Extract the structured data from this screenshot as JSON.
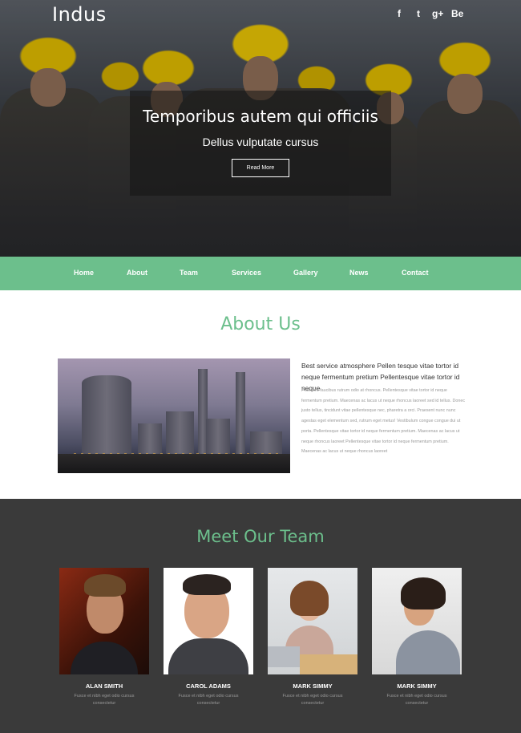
{
  "header": {
    "logo": "Indus",
    "social_icons": [
      {
        "name": "facebook-icon",
        "glyph": "f"
      },
      {
        "name": "twitter-icon",
        "glyph": "t"
      },
      {
        "name": "google-plus-icon",
        "glyph": "g+"
      },
      {
        "name": "behance-icon",
        "glyph": "Be"
      }
    ]
  },
  "hero": {
    "title": "Temporibus autem qui officiis",
    "subtitle": "Dellus vulputate cursus",
    "button_label": "Read More"
  },
  "nav": {
    "items": [
      {
        "label": "Home"
      },
      {
        "label": "About"
      },
      {
        "label": "Team"
      },
      {
        "label": "Services"
      },
      {
        "label": "Gallery"
      },
      {
        "label": "News"
      },
      {
        "label": "Contact"
      }
    ]
  },
  "about": {
    "title": "About Us",
    "heading": "Best service atmosphere Pellen tesque vitae tortor id neque fermentum pretium Pellentesque vitae tortor id neque",
    "body": "Praesent faucibus rutrum odio at rhoncus. Pellentesque vitae tortor id neque fermentum pretium. Maecenas ac lacus ut neque rhoncus laoreet sed id tellus. Donec justo tellus, tincidunt vitae pellentesque nec, pharetra a orci. Praesent nunc nunc agestas eget elementum sed, rutrum eget metus! Vestibulum congue congue dui ut porta. Pellentesque vitae tortor id neque fermentum pretium. Maecenas ac lacus ut neque rhoncus laoreet Pellentesque vitae tortor id neque fermentum pretium. Maecenas ac lacus ut neque rhoncus laoreet"
  },
  "team": {
    "title": "Meet Our Team",
    "members": [
      {
        "name": "ALAN SMITH",
        "desc": "Fusce et nibh eget odio cursus consectetur"
      },
      {
        "name": "CAROL ADAMS",
        "desc": "Fusce et nibh eget odio cursus consectetur"
      },
      {
        "name": "MARK SIMMY",
        "desc": "Fusce et nibh eget odio cursus consectetur"
      },
      {
        "name": "MARK SIMMY",
        "desc": "Fusce et nibh eget odio cursus consectetur"
      }
    ]
  },
  "colors": {
    "accent": "#6cbf8c",
    "dark_section": "#3a3a3a"
  }
}
